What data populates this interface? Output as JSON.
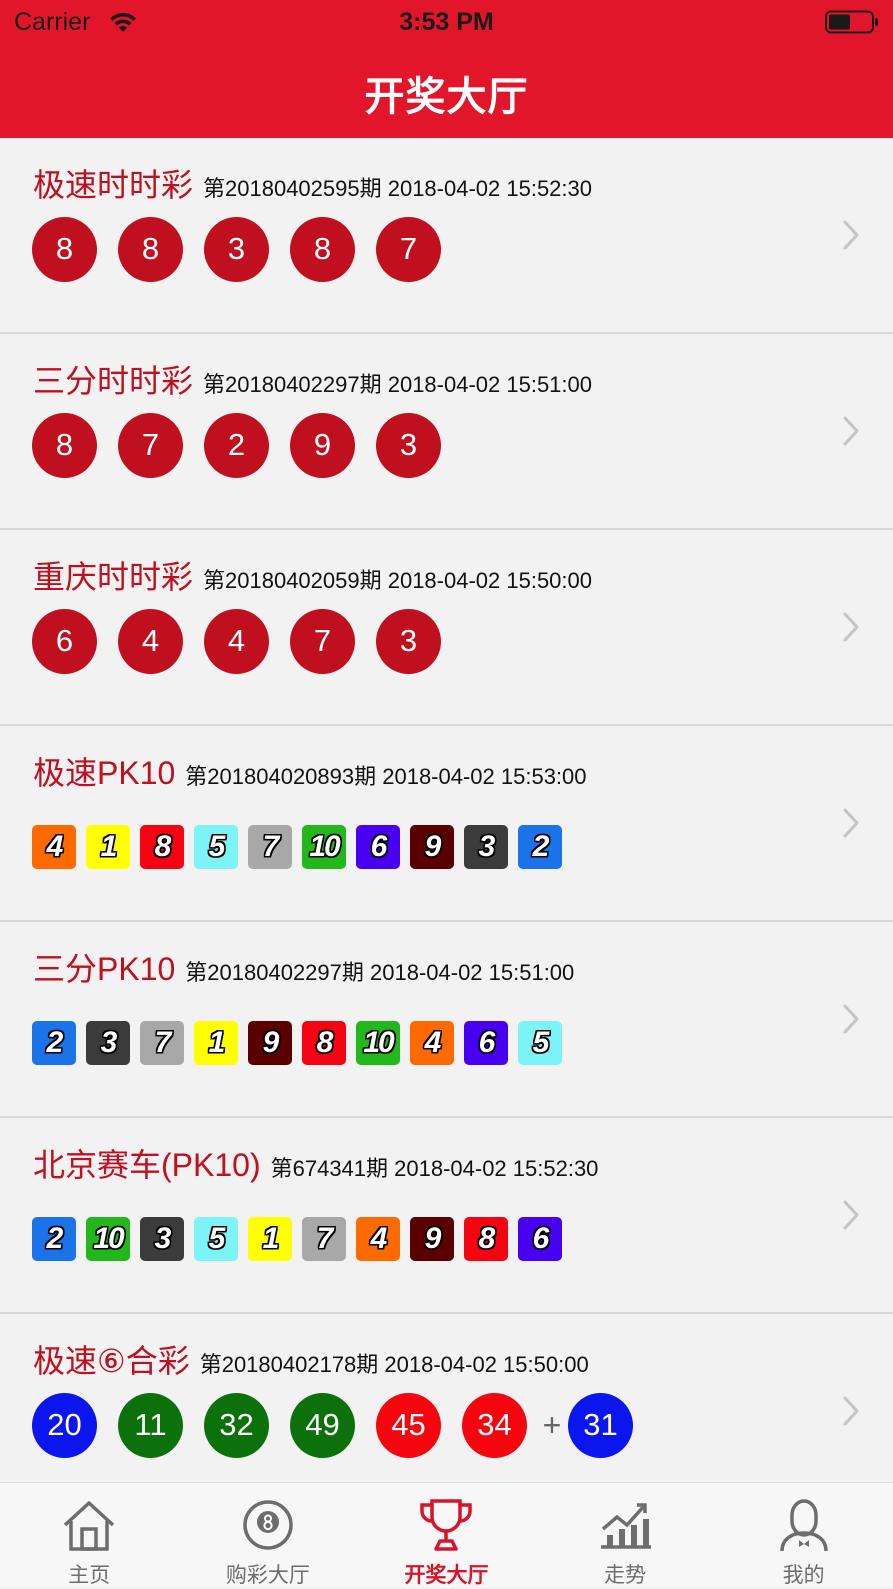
{
  "status_bar": {
    "carrier": "Carrier",
    "time": "3:53 PM"
  },
  "nav": {
    "title": "开奖大厅"
  },
  "colors": {
    "accent": "#e1162a",
    "ball_red": "#c0101f"
  },
  "lotteries": [
    {
      "name": "极速时时彩",
      "period": "第20180402595期 2018-04-02 15:52:30",
      "style": "ball",
      "numbers": [
        "8",
        "8",
        "3",
        "8",
        "7"
      ]
    },
    {
      "name": "三分时时彩",
      "period": "第20180402297期 2018-04-02 15:51:00",
      "style": "ball",
      "numbers": [
        "8",
        "7",
        "2",
        "9",
        "3"
      ]
    },
    {
      "name": "重庆时时彩",
      "period": "第20180402059期 2018-04-02 15:50:00",
      "style": "ball",
      "numbers": [
        "6",
        "4",
        "4",
        "7",
        "3"
      ]
    },
    {
      "name": "极速PK10",
      "period": "第201804020893期 2018-04-02 15:53:00",
      "style": "square",
      "numbers": [
        "4",
        "1",
        "8",
        "5",
        "7",
        "10",
        "6",
        "9",
        "3",
        "2"
      ]
    },
    {
      "name": "三分PK10",
      "period": "第20180402297期 2018-04-02 15:51:00",
      "style": "square",
      "numbers": [
        "2",
        "3",
        "7",
        "1",
        "9",
        "8",
        "10",
        "4",
        "6",
        "5"
      ]
    },
    {
      "name": "北京赛车(PK10)",
      "period": "第674341期 2018-04-02 15:52:30",
      "style": "square",
      "numbers": [
        "2",
        "10",
        "3",
        "5",
        "1",
        "7",
        "4",
        "9",
        "8",
        "6"
      ]
    },
    {
      "name": "极速⑥合彩",
      "period": "第20180402178期 2018-04-02 15:50:00",
      "style": "ball",
      "numbers": [
        "20",
        "11",
        "32",
        "49",
        "45",
        "34"
      ],
      "special_separator": "+",
      "special": "31",
      "ball_colors": [
        "#0b16ee",
        "#0c710b",
        "#0c710b",
        "#0c710b",
        "#f5060f",
        "#f5060f"
      ],
      "special_color": "#0b16ee"
    }
  ],
  "pk10_colors": {
    "1": "#ffff00",
    "2": "#1a73e8",
    "3": "#3b3b3b",
    "4": "#ff6a00",
    "5": "#7cf3f6",
    "6": "#4800f0",
    "7": "#a8a8a8",
    "8": "#f40410",
    "9": "#5a0000",
    "10": "#22b81c"
  },
  "tabs": [
    {
      "label": "主页",
      "icon": "home-icon",
      "active": false
    },
    {
      "label": "购彩大厅",
      "icon": "billiard-ball-icon",
      "active": false
    },
    {
      "label": "开奖大厅",
      "icon": "trophy-icon",
      "active": true
    },
    {
      "label": "走势",
      "icon": "trend-chart-icon",
      "active": false
    },
    {
      "label": "我的",
      "icon": "profile-icon",
      "active": false
    }
  ]
}
